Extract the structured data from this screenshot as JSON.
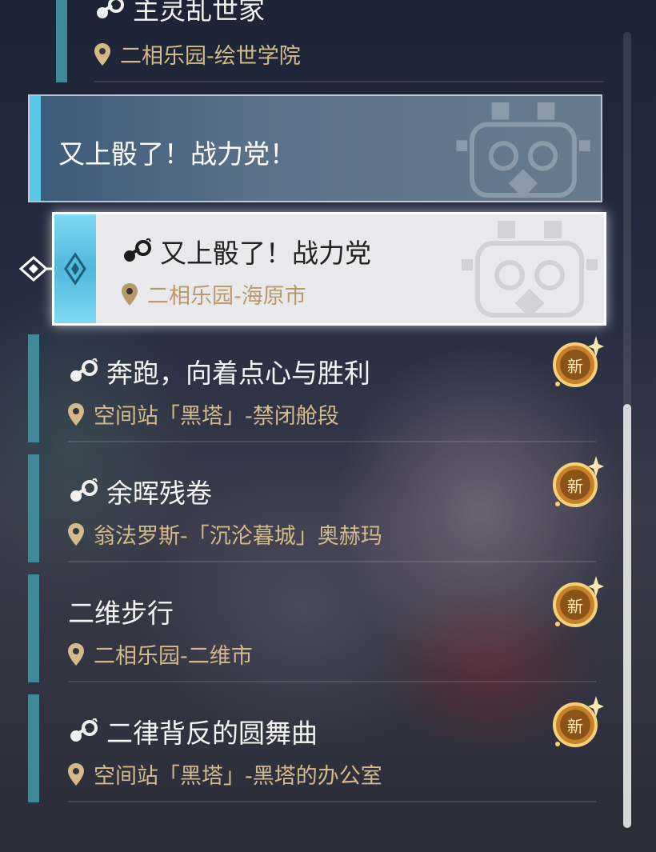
{
  "top_item": {
    "title": "主灵乱世家",
    "location": "二相乐园-绘世学院"
  },
  "group_header": {
    "title": "又上骰了！战力党！"
  },
  "selected_item": {
    "title": "又上骰了！战力党",
    "location": "二相乐园-海原市"
  },
  "items": [
    {
      "title": "奔跑，向着点心与胜利",
      "location": "空间站「黑塔」-禁闭舱段",
      "badge": "新"
    },
    {
      "title": "余晖残卷",
      "location": "翁法罗斯-「沉沦暮城」奥赫玛",
      "badge": "新"
    },
    {
      "title": "二维步行",
      "location": "二相乐园-二维市",
      "badge": "新"
    },
    {
      "title": "二律背反的圆舞曲",
      "location": "空间站「黑塔」-黑塔的办公室",
      "badge": "新"
    }
  ],
  "icons": {
    "quest": "chain-link-icon",
    "location": "location-pin-icon",
    "new_badge": "new-badge-icon",
    "selector": "diamond-cursor-icon"
  },
  "colors": {
    "accent_bar": "#3f8a9a",
    "header_bar": "#57c8e8",
    "location_text": "#d4b98a",
    "badge_gold": "#e8a23a"
  }
}
